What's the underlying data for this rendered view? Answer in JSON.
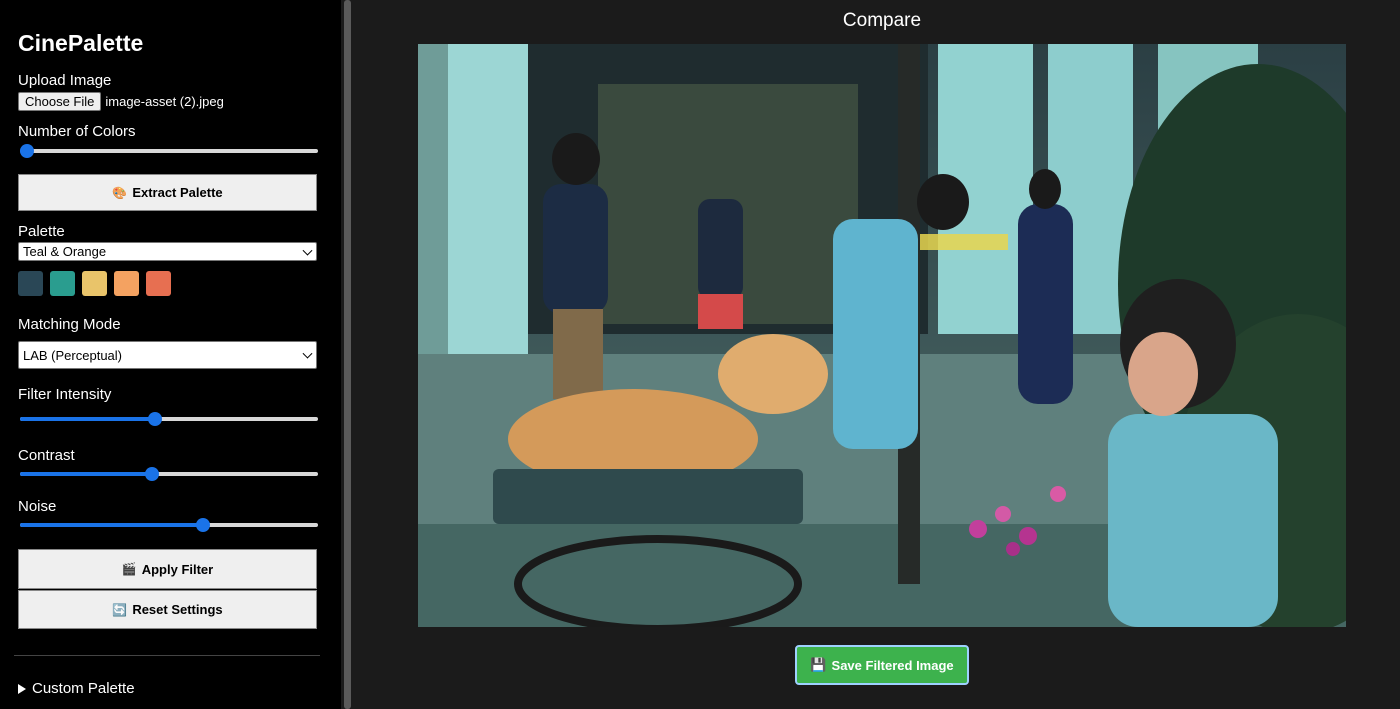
{
  "app": {
    "title": "CinePalette"
  },
  "upload": {
    "label": "Upload Image",
    "button": "Choose File",
    "file_name": "image-asset (2).jpeg"
  },
  "colors": {
    "label": "Number of Colors",
    "value": 0.0
  },
  "extract": {
    "icon": "palette-icon",
    "label": "Extract Palette"
  },
  "palette": {
    "label": "Palette",
    "selected": "Teal & Orange",
    "swatches": [
      "#2a4756",
      "#2a9d8f",
      "#e9c46a",
      "#f4a261",
      "#e76f51"
    ]
  },
  "matching": {
    "label": "Matching Mode",
    "selected": "LAB (Perceptual)"
  },
  "intensity": {
    "label": "Filter Intensity",
    "value": 0.45
  },
  "contrast": {
    "label": "Contrast",
    "value": 0.44
  },
  "noise": {
    "label": "Noise",
    "value": 0.62
  },
  "apply": {
    "icon": "clapperboard-icon",
    "label": "Apply Filter"
  },
  "reset": {
    "icon": "refresh-icon",
    "label": "Reset Settings"
  },
  "custom": {
    "label": "Custom Palette"
  },
  "main": {
    "title": "Compare"
  },
  "save": {
    "icon": "floppy-disk-icon",
    "label": "Save Filtered Image"
  }
}
